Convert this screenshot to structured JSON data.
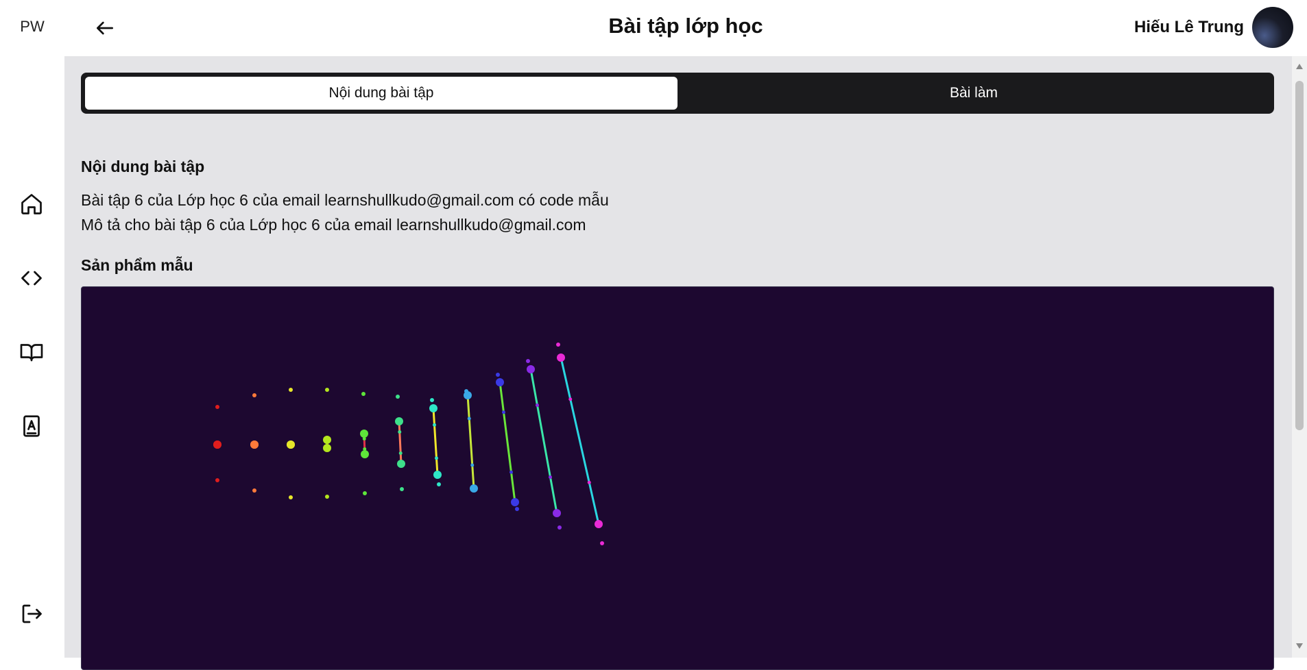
{
  "app": {
    "logo_text": "PW"
  },
  "sidebar": {
    "items": [
      {
        "name": "home",
        "icon": "home-icon"
      },
      {
        "name": "code",
        "icon": "code-icon"
      },
      {
        "name": "book",
        "icon": "book-open-icon"
      },
      {
        "name": "contacts",
        "icon": "contact-book-icon"
      }
    ],
    "logout_icon": "logout-icon"
  },
  "header": {
    "title": "Bài tập lớp học",
    "back_icon": "arrow-left-icon",
    "user_name": "Hiếu Lê Trung"
  },
  "tabs": [
    {
      "label": "Nội dung bài tập",
      "active": true
    },
    {
      "label": "Bài làm",
      "active": false
    }
  ],
  "content": {
    "heading": "Nội dung bài tập",
    "lines": [
      "Bài tập 6 của Lớp học 6 của email learnshullkudo@gmail.com có code mẫu",
      "Mô tả cho bài tập 6 của Lớp học 6 của email learnshullkudo@gmail.com"
    ],
    "sample_heading": "Sản phẩm mẫu"
  },
  "sample": {
    "background": "#1d0830",
    "columns": [
      {
        "color": "#e01d1d",
        "bar_color": "#e01d1d"
      },
      {
        "color": "#ff7a3a",
        "bar_color": "#ff7a3a"
      },
      {
        "color": "#e6e62a",
        "bar_color": "#e6e62a"
      },
      {
        "color": "#b4e61e",
        "bar_color": "#ff9a2a"
      },
      {
        "color": "#5ee63a",
        "bar_color": "#e0304a"
      },
      {
        "color": "#3ee08a",
        "bar_color": "#ff7a5a"
      },
      {
        "color": "#2ee6c6",
        "bar_color": "#f0e62a"
      },
      {
        "color": "#3aa8e6",
        "bar_color": "#c6e63a"
      },
      {
        "color": "#3a3ae6",
        "bar_color": "#6ae63a"
      },
      {
        "color": "#8a2ae6",
        "bar_color": "#3ae6a8"
      },
      {
        "color": "#ea2ad6",
        "bar_color": "#2ad6e0"
      }
    ]
  }
}
